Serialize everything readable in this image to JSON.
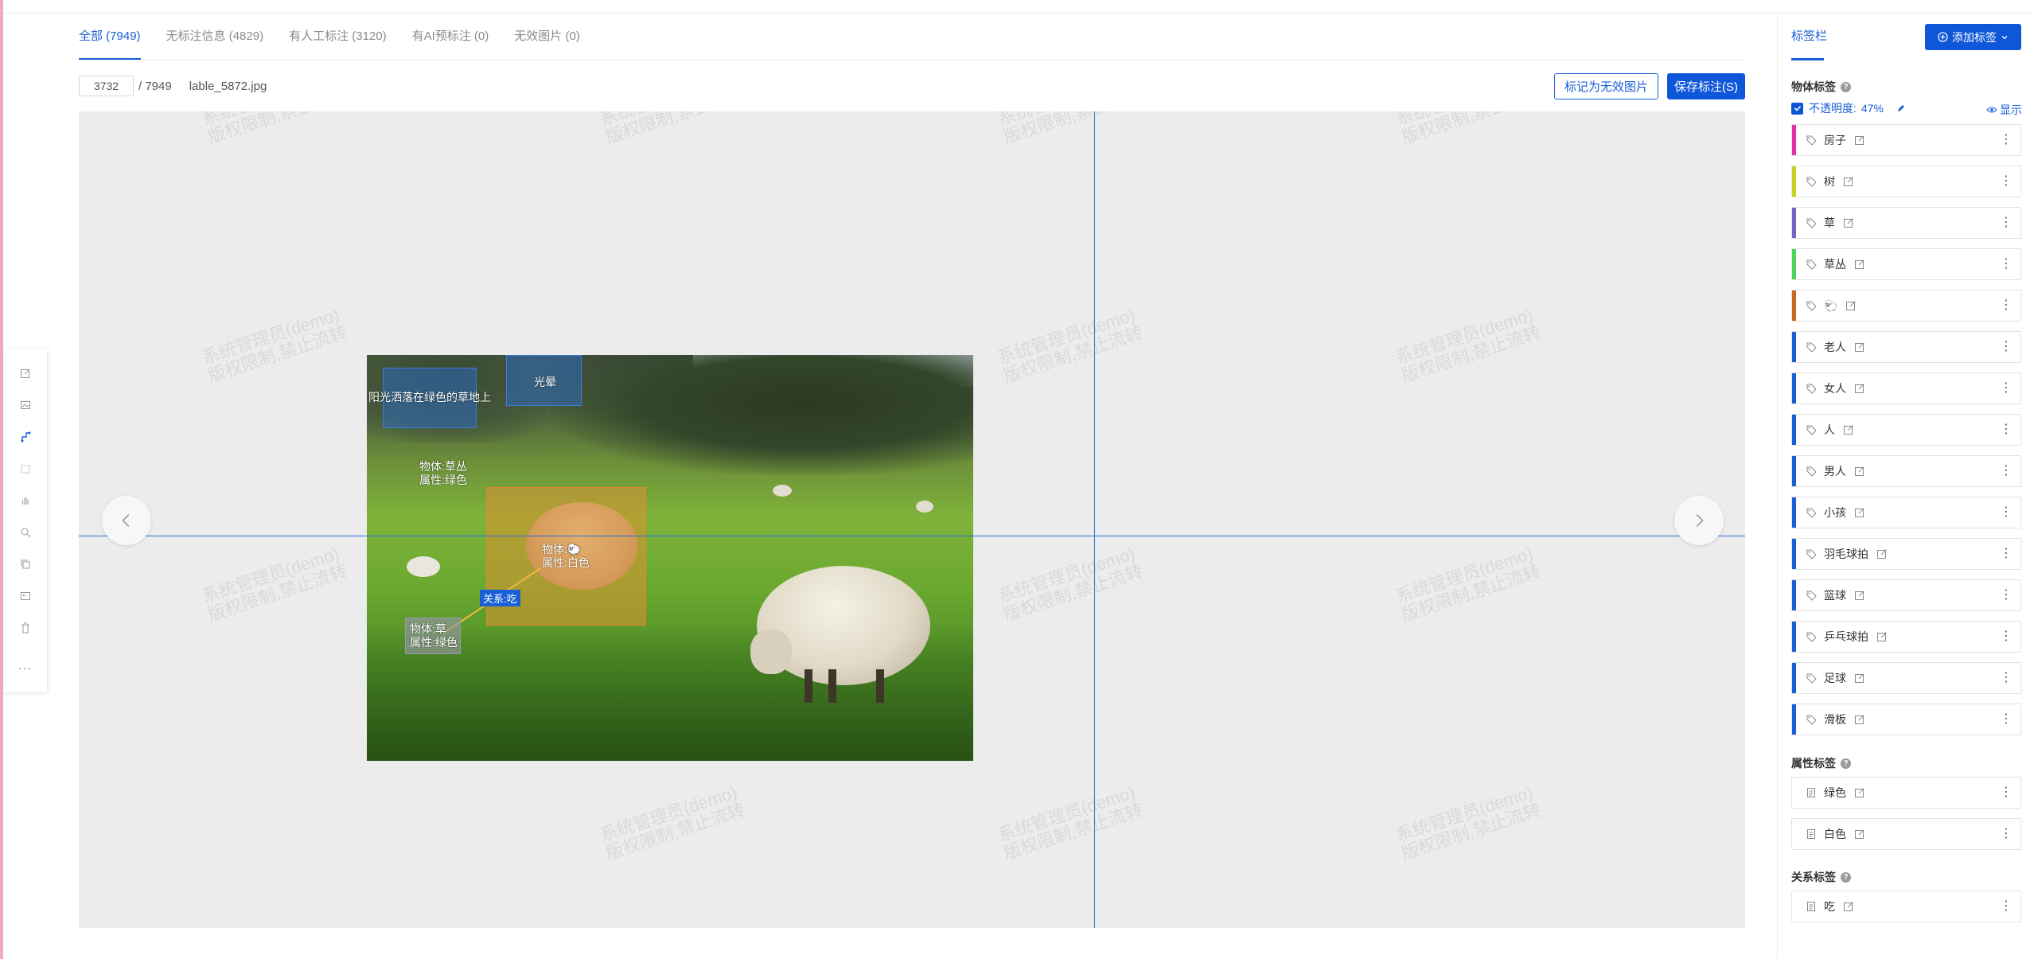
{
  "tabs": [
    {
      "label": "全部 (7949)",
      "active": true
    },
    {
      "label": "无标注信息 (4829)",
      "active": false
    },
    {
      "label": "有人工标注 (3120)",
      "active": false
    },
    {
      "label": "有AI预标注 (0)",
      "active": false
    },
    {
      "label": "无效图片 (0)",
      "active": false
    }
  ],
  "toolbar": {
    "page_value": "3732",
    "page_total": "/ 7949",
    "filename": "lable_5872.jpg",
    "mark_invalid_label": "标记为无效图片",
    "save_label": "保存标注(S)"
  },
  "watermark": {
    "line1": "系统管理员(demo)",
    "line2": "版权限制,禁止流转"
  },
  "annotations": {
    "sunlight": "阳光洒落在绿色的草地上",
    "halo": "光晕",
    "bush_object": "物体:草丛",
    "bush_attr": "属性:绿色",
    "sheep_object": "物体:🐑",
    "sheep_attr": "属性:白色",
    "relation": "关系:吃",
    "grass_object": "物体:草",
    "grass_attr": "属性:绿色"
  },
  "tools": [
    "edit-box-icon",
    "image-icon",
    "polygon-icon",
    "crop-icon",
    "hand-icon",
    "magnify-icon",
    "copy-icon",
    "picture-icon",
    "trash-icon",
    "more-icon"
  ],
  "right_panel": {
    "title": "标签栏",
    "add_label": "添加标签",
    "object_section": "物体标签",
    "opacity_label": "不透明度:",
    "opacity_value": "47%",
    "show_label": "显示",
    "attr_section": "属性标签",
    "relation_section": "关系标签",
    "object_tags": [
      {
        "name": "房子",
        "color": "#e02fa8"
      },
      {
        "name": "树",
        "color": "#c6d120"
      },
      {
        "name": "草",
        "color": "#7b62c9"
      },
      {
        "name": "草丛",
        "color": "#4fd45a"
      },
      {
        "name": "🐑",
        "color": "#c9681e"
      },
      {
        "name": "老人",
        "color": "#1a5fd6"
      },
      {
        "name": "女人",
        "color": "#1a5fd6"
      },
      {
        "name": "人",
        "color": "#1a5fd6"
      },
      {
        "name": "男人",
        "color": "#1a5fd6"
      },
      {
        "name": "小孩",
        "color": "#1a5fd6"
      },
      {
        "name": "羽毛球拍",
        "color": "#1a5fd6"
      },
      {
        "name": "篮球",
        "color": "#1a5fd6"
      },
      {
        "name": "乒乓球拍",
        "color": "#1a5fd6"
      },
      {
        "name": "足球",
        "color": "#1a5fd6"
      },
      {
        "name": "滑板",
        "color": "#1a5fd6"
      }
    ],
    "attr_tags": [
      {
        "name": "绿色"
      },
      {
        "name": "白色"
      }
    ],
    "relation_tags": [
      {
        "name": "吃"
      }
    ]
  },
  "colors": {
    "accent": "#1a5fd6",
    "primary_button": "#0f57d9",
    "crosshair": "#2b6ddb"
  }
}
